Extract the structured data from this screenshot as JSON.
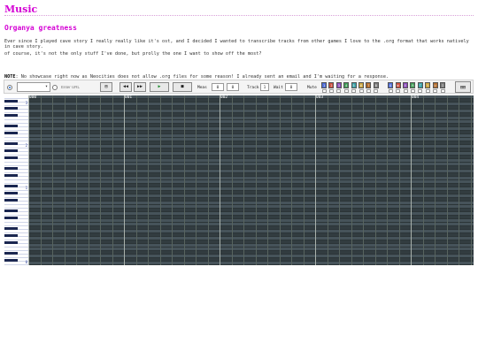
{
  "page": {
    "title": "Music",
    "heading": "Organya greatness",
    "intro": "Ever since I played cave story I really really like it's ost, and I decided I wanted to transcribe tracks from other games I love to the .org format that works natively in cave story.",
    "intro2": "of course, it's not the only stuff I've done, but prolly the one I want to show off the most?",
    "note_label": "NOTE",
    "note_text": ": No showcase right now as Neocities does not allow .org files for some reason! I already sent an email and I'm waiting for a response."
  },
  "toolbar": {
    "url_placeholder": "Enter URL",
    "meas_label": "Meas",
    "meas_value_1": "0",
    "meas_value_2": "0",
    "track_label": "Track",
    "track_value": "1",
    "wait_label": "Wait",
    "wait_value": "0",
    "mute_label": "Mute",
    "mute_tracks": [
      "1",
      "2",
      "3",
      "4",
      "5",
      "6",
      "7",
      "8",
      "Q",
      "W",
      "E",
      "R",
      "T",
      "Y",
      "U",
      "I"
    ],
    "colors": {
      "melody": [
        "#4d6bd6",
        "#c84a3a",
        "#8a49b8",
        "#3f9a55",
        "#3aa0a6",
        "#c9a23b",
        "#b06a2b",
        "#7a7a7a"
      ],
      "drum": [
        "#4d6bd6",
        "#c84a3a",
        "#8a49b8",
        "#3f9a55",
        "#3aa0a6",
        "#c9a23b",
        "#b06a2b",
        "#7a7a7a"
      ]
    }
  },
  "roll": {
    "measures": [
      "000",
      "001",
      "002",
      "003",
      "004"
    ],
    "octaves": [
      "3",
      "2",
      "1",
      "0"
    ]
  }
}
